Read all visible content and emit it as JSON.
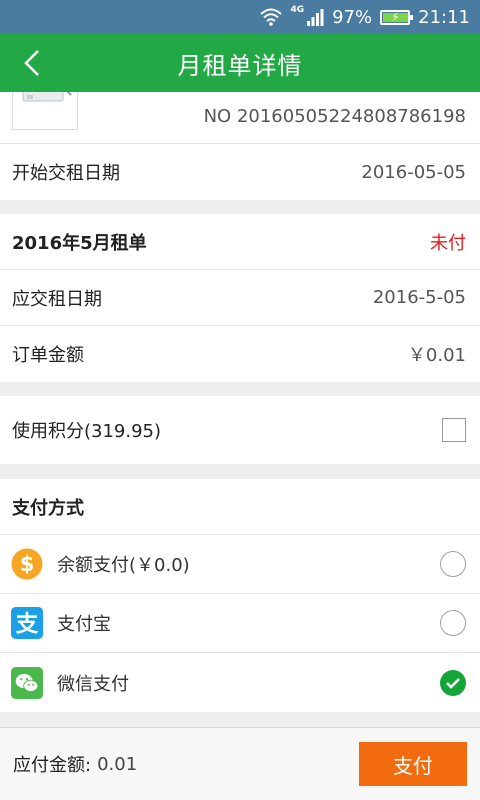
{
  "status_bar": {
    "network": "4G",
    "battery": "97%",
    "battery_level": 0.97,
    "time": "21:11"
  },
  "header": {
    "title": "月租单详情",
    "back_icon": "chevron-left-icon"
  },
  "order": {
    "number": "NO 20160505224808786198"
  },
  "rent_start": {
    "label": "开始交租日期",
    "value": "2016-05-05"
  },
  "bill": {
    "title": "2016年5月租单",
    "status": "未付",
    "due_date": {
      "label": "应交租日期",
      "value": "2016-5-05"
    },
    "amount": {
      "label": "订单金额",
      "value": "￥0.01"
    }
  },
  "points": {
    "label": "使用积分(319.95)",
    "checked": false
  },
  "payment": {
    "title": "支付方式",
    "options": [
      {
        "label": "余额支付(￥0.0)",
        "icon": "dollar-coin-icon",
        "selected": false
      },
      {
        "label": "支付宝",
        "icon": "alipay-icon",
        "selected": false
      },
      {
        "label": "微信支付",
        "icon": "wechat-icon",
        "selected": true
      }
    ]
  },
  "footer": {
    "due_label": "应付金额:",
    "due_value": "0.01",
    "pay_button": "支付"
  },
  "colors": {
    "header_bg": "#22a845",
    "status_bar_bg": "#4a7ba0",
    "pay_button": "#f26b0f",
    "unpaid": "#e51c1c",
    "check": "#13a538"
  }
}
